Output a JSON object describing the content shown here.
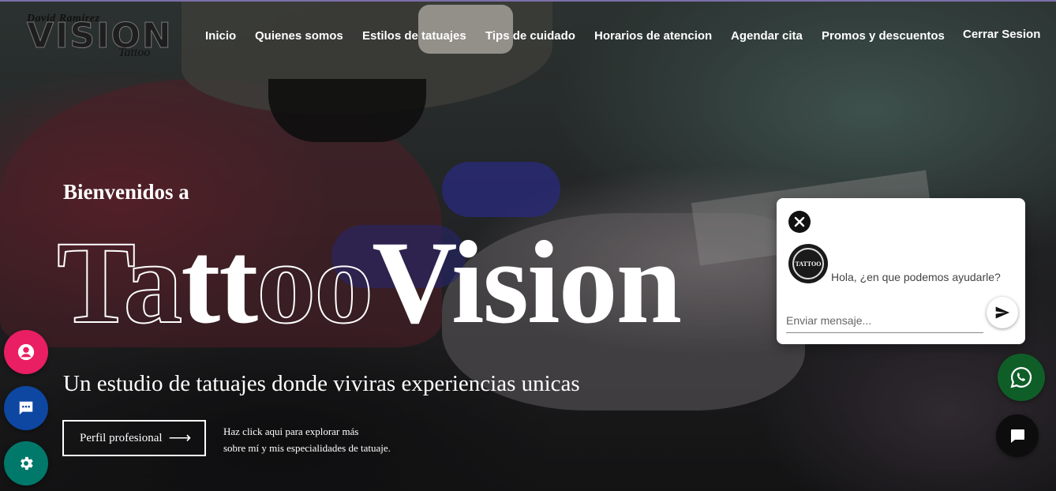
{
  "logo": {
    "top_text": "David Ramirez",
    "main_text": "VISION",
    "sub_text": "Tattoo",
    "icon": "brand-logo"
  },
  "nav": {
    "items": [
      {
        "label": "Inicio"
      },
      {
        "label": "Quienes somos"
      },
      {
        "label": "Estilos de tatuajes"
      },
      {
        "label": "Tips de cuidado"
      },
      {
        "label": "Horarios de atencion"
      },
      {
        "label": "Agendar cita"
      },
      {
        "label": "Promos y descuentos"
      },
      {
        "label": "Cerrar Sesion"
      }
    ]
  },
  "hero": {
    "welcome": "Bienvenidos a",
    "brand_part1": "Ta",
    "brand_part2": "tt",
    "brand_part3": "oo",
    "brand_part4": "Vision",
    "tagline": "Un estudio de tatuajes donde viviras experiencias unicas",
    "profile_button": "Perfil profesional",
    "profile_arrow": "⟶",
    "help_line1": "Haz click aqui para explorar más",
    "help_line2": "sobre mí y mis especialidades de tatuaje."
  },
  "floating": {
    "user_icon": "user-circle-icon",
    "chat_icon": "chat-bubble-icon",
    "settings_icon": "gear-icon",
    "whatsapp_icon": "whatsapp-icon",
    "message_icon": "message-icon"
  },
  "chat": {
    "avatar_text": "TATTOO",
    "greeting": "Hola, ¿en que podemos ayudarle?",
    "input_placeholder": "Enviar mensaje...",
    "input_value": ""
  },
  "colors": {
    "user_fab": "#e91e63",
    "chat_fab": "#0d47a1",
    "settings_fab": "#00796b",
    "whatsapp_fab": "#0f5e28",
    "message_fab": "#0d0d0d"
  }
}
